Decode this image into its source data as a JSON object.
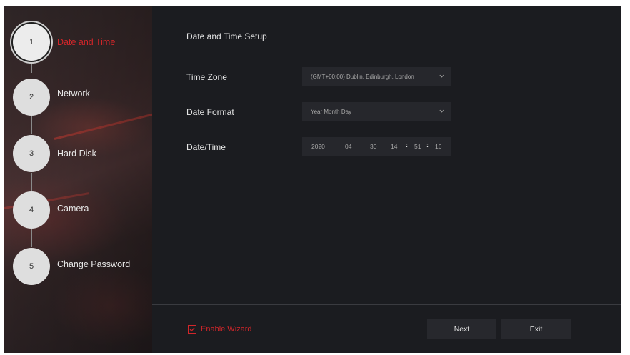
{
  "sidebar": {
    "steps": [
      {
        "number": "1",
        "label": "Date and Time",
        "active": true
      },
      {
        "number": "2",
        "label": "Network",
        "active": false
      },
      {
        "number": "3",
        "label": "Hard Disk",
        "active": false
      },
      {
        "number": "4",
        "label": "Camera",
        "active": false
      },
      {
        "number": "5",
        "label": "Change Password",
        "active": false
      }
    ]
  },
  "main": {
    "title": "Date and Time Setup",
    "time_zone": {
      "label": "Time Zone",
      "value": "(GMT+00:00) Dublin, Edinburgh, London"
    },
    "date_format": {
      "label": "Date Format",
      "value": "Year Month Day"
    },
    "date_time": {
      "label": "Date/Time",
      "year": "2020",
      "month": "04",
      "day": "30",
      "hour": "14",
      "minute": "51",
      "second": "16",
      "date_separator": "–",
      "time_separator": ":"
    }
  },
  "footer": {
    "enable_wizard_label": "Enable Wizard",
    "enable_wizard_checked": true,
    "next_label": "Next",
    "exit_label": "Exit"
  },
  "colors": {
    "accent": "#d2262a",
    "background": "#1b1c20",
    "field": "#26272c"
  },
  "icons": {
    "dropdown": "chevron-down-icon",
    "check": "checkmark-icon"
  }
}
